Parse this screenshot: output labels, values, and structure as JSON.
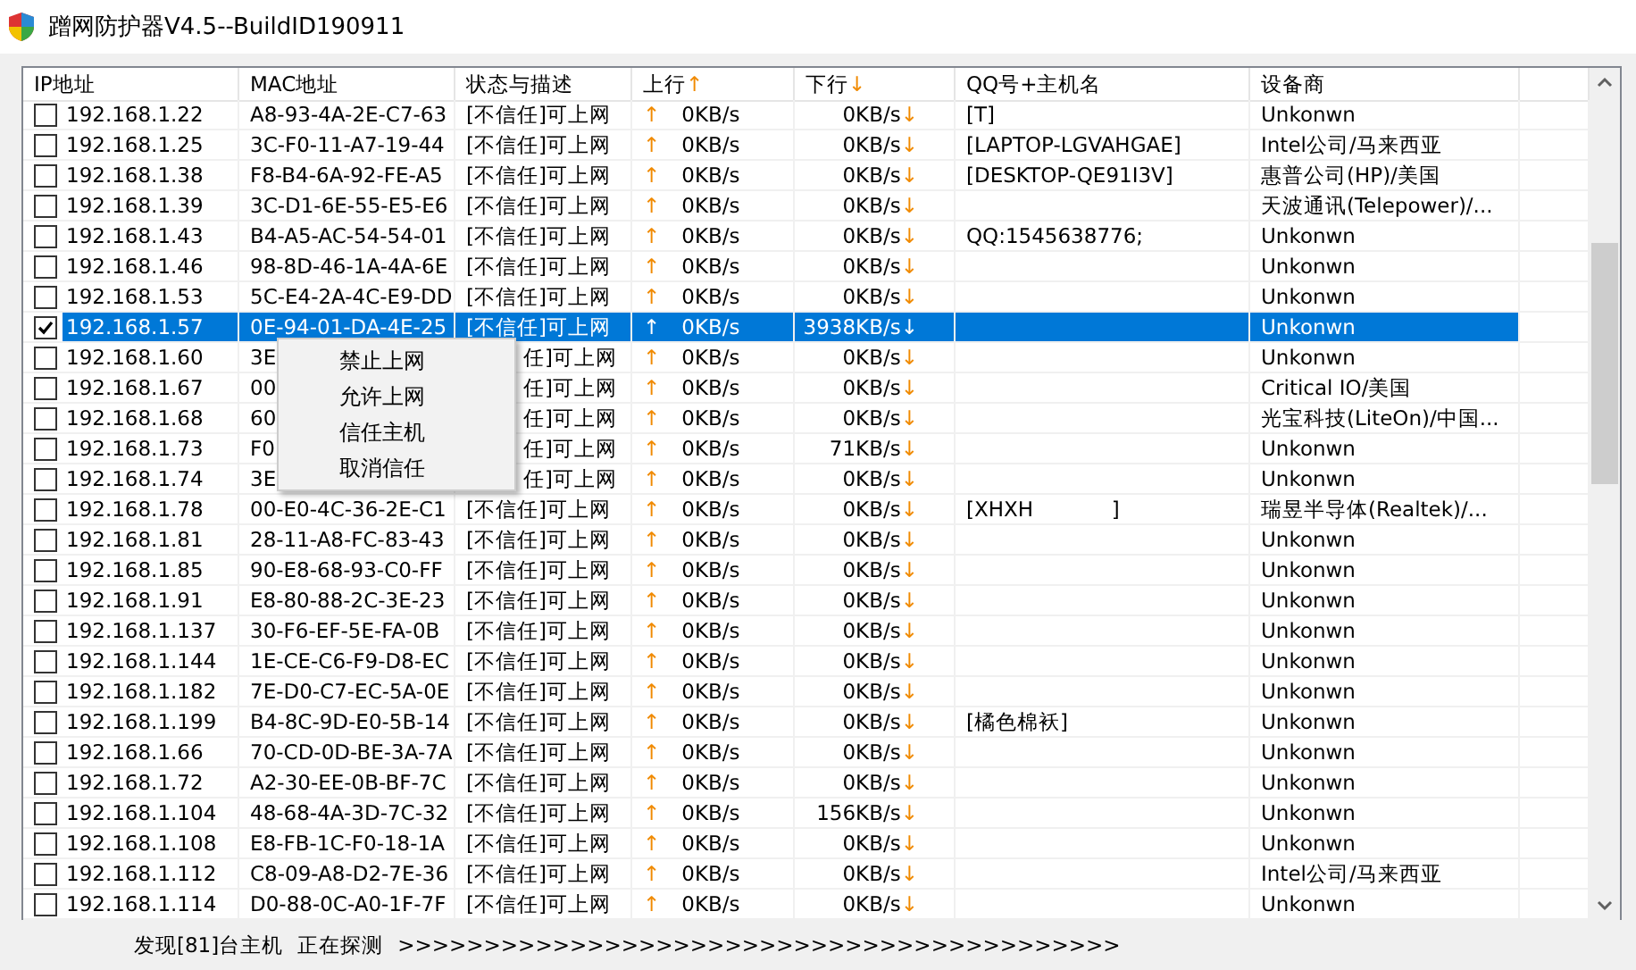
{
  "window": {
    "title": "蹭网防护器V4.5--BuildID190911"
  },
  "table": {
    "columns": [
      {
        "label": "IP地址"
      },
      {
        "label": "MAC地址"
      },
      {
        "label": "状态与描述"
      },
      {
        "label": "上行",
        "arrow": "↑"
      },
      {
        "label": "下行",
        "arrow": "↓"
      },
      {
        "label": "QQ号+主机名"
      },
      {
        "label": "设备商"
      }
    ],
    "rows": [
      {
        "checked": false,
        "selected": false,
        "ip": "192.168.1.22",
        "mac": "A8-93-4A-2E-C7-63",
        "status": "[不信任]可上网",
        "up_arrow": "↑",
        "up": "0KB/s",
        "down": "0KB/s",
        "down_arrow": "↓",
        "host": "[T]",
        "vendor": "Unkonwn"
      },
      {
        "checked": false,
        "selected": false,
        "ip": "192.168.1.25",
        "mac": "3C-F0-11-A7-19-44",
        "status": "[不信任]可上网",
        "up_arrow": "↑",
        "up": "0KB/s",
        "down": "0KB/s",
        "down_arrow": "↓",
        "host": "[LAPTOP-LGVAHGAE]",
        "vendor": "Intel公司/马来西亚"
      },
      {
        "checked": false,
        "selected": false,
        "ip": "192.168.1.38",
        "mac": "F8-B4-6A-92-FE-A5",
        "status": "[不信任]可上网",
        "up_arrow": "↑",
        "up": "0KB/s",
        "down": "0KB/s",
        "down_arrow": "↓",
        "host": "[DESKTOP-QE91I3V]",
        "vendor": "惠普公司(HP)/美国"
      },
      {
        "checked": false,
        "selected": false,
        "ip": "192.168.1.39",
        "mac": "3C-D1-6E-55-E5-E6",
        "status": "[不信任]可上网",
        "up_arrow": "↑",
        "up": "0KB/s",
        "down": "0KB/s",
        "down_arrow": "↓",
        "vendor": "天波通讯(Telepower)/..."
      },
      {
        "checked": false,
        "selected": false,
        "ip": "192.168.1.43",
        "mac": "B4-A5-AC-54-54-01",
        "status": "[不信任]可上网",
        "up_arrow": "↑",
        "up": "0KB/s",
        "down": "0KB/s",
        "down_arrow": "↓",
        "host": "QQ:1545638776;",
        "vendor": "Unkonwn"
      },
      {
        "checked": false,
        "selected": false,
        "ip": "192.168.1.46",
        "mac": "98-8D-46-1A-4A-6E",
        "status": "[不信任]可上网",
        "up_arrow": "↑",
        "up": "0KB/s",
        "down": "0KB/s",
        "down_arrow": "↓",
        "vendor": "Unkonwn"
      },
      {
        "checked": false,
        "selected": false,
        "ip": "192.168.1.53",
        "mac": "5C-E4-2A-4C-E9-DD",
        "status": "[不信任]可上网",
        "up_arrow": "↑",
        "up": "0KB/s",
        "down": "0KB/s",
        "down_arrow": "↓",
        "vendor": "Unkonwn"
      },
      {
        "checked": true,
        "selected": true,
        "ip": "192.168.1.57",
        "mac": "0E-94-01-DA-4E-25",
        "status": "[不信任]可上网",
        "up_arrow": "↑",
        "up": "0KB/s",
        "down": "3938KB/s",
        "down_arrow": "↓",
        "vendor": "Unkonwn"
      },
      {
        "checked": false,
        "selected": false,
        "covered": true,
        "ip": "192.168.1.60",
        "mac": "3E",
        "status": "任]可上网",
        "up_arrow": "↑",
        "up": "0KB/s",
        "down": "0KB/s",
        "down_arrow": "↓",
        "vendor": "Unkonwn"
      },
      {
        "checked": false,
        "selected": false,
        "covered": true,
        "ip": "192.168.1.67",
        "mac": "00",
        "status": "任]可上网",
        "up_arrow": "↑",
        "up": "0KB/s",
        "down": "0KB/s",
        "down_arrow": "↓",
        "vendor": "Critical IO/美国"
      },
      {
        "checked": false,
        "selected": false,
        "covered": true,
        "ip": "192.168.1.68",
        "mac": "60",
        "status": "任]可上网",
        "up_arrow": "↑",
        "up": "0KB/s",
        "down": "0KB/s",
        "down_arrow": "↓",
        "vendor": "光宝科技(LiteOn)/中国..."
      },
      {
        "checked": false,
        "selected": false,
        "covered": true,
        "ip": "192.168.1.73",
        "mac": "F0",
        "status": "任]可上网",
        "up_arrow": "↑",
        "up": "0KB/s",
        "down": "71KB/s",
        "down_arrow": "↓",
        "vendor": "Unkonwn"
      },
      {
        "checked": false,
        "selected": false,
        "covered": true,
        "ip": "192.168.1.74",
        "mac": "3E",
        "status": "任]可上网",
        "up_arrow": "↑",
        "up": "0KB/s",
        "down": "0KB/s",
        "down_arrow": "↓",
        "vendor": "Unkonwn"
      },
      {
        "checked": false,
        "selected": false,
        "ip": "192.168.1.78",
        "mac": "00-E0-4C-36-2E-C1",
        "status": "[不信任]可上网",
        "up_arrow": "↑",
        "up": "0KB/s",
        "down": "0KB/s",
        "down_arrow": "↓",
        "host": "[XHXH            ]",
        "vendor": "瑞昱半导体(Realtek)/..."
      },
      {
        "checked": false,
        "selected": false,
        "ip": "192.168.1.81",
        "mac": "28-11-A8-FC-83-43",
        "status": "[不信任]可上网",
        "up_arrow": "↑",
        "up": "0KB/s",
        "down": "0KB/s",
        "down_arrow": "↓",
        "vendor": "Unkonwn"
      },
      {
        "checked": false,
        "selected": false,
        "ip": "192.168.1.85",
        "mac": "90-E8-68-93-C0-FF",
        "status": "[不信任]可上网",
        "up_arrow": "↑",
        "up": "0KB/s",
        "down": "0KB/s",
        "down_arrow": "↓",
        "vendor": "Unkonwn"
      },
      {
        "checked": false,
        "selected": false,
        "ip": "192.168.1.91",
        "mac": "E8-80-88-2C-3E-23",
        "status": "[不信任]可上网",
        "up_arrow": "↑",
        "up": "0KB/s",
        "down": "0KB/s",
        "down_arrow": "↓",
        "vendor": "Unkonwn"
      },
      {
        "checked": false,
        "selected": false,
        "ip": "192.168.1.137",
        "mac": "30-F6-EF-5E-FA-0B",
        "status": "[不信任]可上网",
        "up_arrow": "↑",
        "up": "0KB/s",
        "down": "0KB/s",
        "down_arrow": "↓",
        "vendor": "Unkonwn"
      },
      {
        "checked": false,
        "selected": false,
        "ip": "192.168.1.144",
        "mac": "1E-CE-C6-F9-D8-EC",
        "status": "[不信任]可上网",
        "up_arrow": "↑",
        "up": "0KB/s",
        "down": "0KB/s",
        "down_arrow": "↓",
        "vendor": "Unkonwn"
      },
      {
        "checked": false,
        "selected": false,
        "ip": "192.168.1.182",
        "mac": "7E-D0-C7-EC-5A-0E",
        "status": "[不信任]可上网",
        "up_arrow": "↑",
        "up": "0KB/s",
        "down": "0KB/s",
        "down_arrow": "↓",
        "vendor": "Unkonwn"
      },
      {
        "checked": false,
        "selected": false,
        "ip": "192.168.1.199",
        "mac": "B4-8C-9D-E0-5B-14",
        "status": "[不信任]可上网",
        "up_arrow": "↑",
        "up": "0KB/s",
        "down": "0KB/s",
        "down_arrow": "↓",
        "host": "[橘色棉袄]",
        "vendor": "Unkonwn"
      },
      {
        "checked": false,
        "selected": false,
        "ip": "192.168.1.66",
        "mac": "70-CD-0D-BE-3A-7A",
        "status": "[不信任]可上网",
        "up_arrow": "↑",
        "up": "0KB/s",
        "down": "0KB/s",
        "down_arrow": "↓",
        "vendor": "Unkonwn"
      },
      {
        "checked": false,
        "selected": false,
        "ip": "192.168.1.72",
        "mac": "A2-30-EE-0B-BF-7C",
        "status": "[不信任]可上网",
        "up_arrow": "↑",
        "up": "0KB/s",
        "down": "0KB/s",
        "down_arrow": "↓",
        "vendor": "Unkonwn"
      },
      {
        "checked": false,
        "selected": false,
        "ip": "192.168.1.104",
        "mac": "48-68-4A-3D-7C-32",
        "status": "[不信任]可上网",
        "up_arrow": "↑",
        "up": "0KB/s",
        "down": "156KB/s",
        "down_arrow": "↓",
        "vendor": "Unkonwn"
      },
      {
        "checked": false,
        "selected": false,
        "ip": "192.168.1.108",
        "mac": "E8-FB-1C-F0-18-1A",
        "status": "[不信任]可上网",
        "up_arrow": "↑",
        "up": "0KB/s",
        "down": "0KB/s",
        "down_arrow": "↓",
        "vendor": "Unkonwn"
      },
      {
        "checked": false,
        "selected": false,
        "ip": "192.168.1.112",
        "mac": "C8-09-A8-D2-7E-36",
        "status": "[不信任]可上网",
        "up_arrow": "↑",
        "up": "0KB/s",
        "down": "0KB/s",
        "down_arrow": "↓",
        "vendor": "Intel公司/马来西亚"
      },
      {
        "checked": false,
        "selected": false,
        "ip": "192.168.1.114",
        "mac": "D0-88-0C-A0-1F-7F",
        "status": "[不信任]可上网",
        "up_arrow": "↑",
        "up": "0KB/s",
        "down": "0KB/s",
        "down_arrow": "↓",
        "vendor": "Unkonwn"
      }
    ]
  },
  "context_menu": {
    "items": [
      "禁止上网",
      "允许上网",
      "信任主机",
      "取消信任"
    ]
  },
  "status_bar": {
    "found": "发现[81]台主机",
    "state": "正在探测",
    "progress": ">>>>>>>>>>>>>>>>>>>>>>>>>>>>>>>>>>>>>>>>>>"
  }
}
